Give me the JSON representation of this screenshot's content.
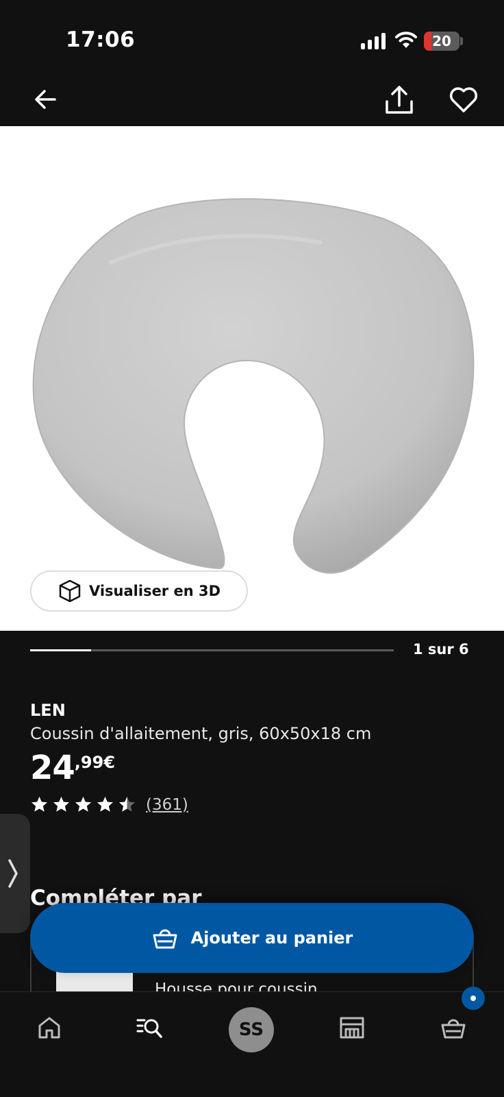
{
  "status_bar": {
    "time": "17:06",
    "battery": "20",
    "battery_level": 0.2
  },
  "icons": {
    "back": "arrow-left-icon",
    "share": "share-icon",
    "favorite": "heart-icon",
    "view_3d": "cube-icon",
    "star": "star-icon",
    "side_handle": "chevron-right-icon",
    "cart": "basket-icon",
    "home": "home-icon",
    "search": "search-list-icon",
    "store": "store-icon"
  },
  "gallery": {
    "view_3d_label": "Visualiser en 3D",
    "counter": "1 sur 6",
    "current": 1,
    "total": 6
  },
  "product": {
    "brand": "LEN",
    "description": "Coussin d'allaitement, gris, 60x50x18 cm",
    "price_int": "24",
    "price_dec": ",99€",
    "rating": 4.5,
    "reviews": "(361)"
  },
  "complete": {
    "title": "Compléter par",
    "item_name": "Housse pour coussin"
  },
  "actions": {
    "add_to_cart": "Ajouter au panier"
  },
  "bottom_nav": {
    "avatar_initials": "SS"
  },
  "colors": {
    "background": "#111111",
    "accent": "#0058a3",
    "image_bg": "#ffffff"
  }
}
